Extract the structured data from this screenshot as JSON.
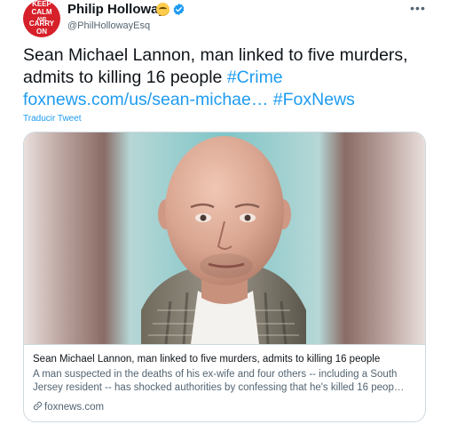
{
  "author": {
    "name": "Philip Holloway",
    "handle": "@PhilHollowayEsq",
    "avatar_text": [
      "KEEP",
      "CALM",
      "AND",
      "CARRY",
      "ON"
    ]
  },
  "tweet": {
    "text_line1": "Sean Michael Lannon, man linked to five murders,",
    "text_line2_plain": "admits to killing 16 people ",
    "hashtag_crime": "#Crime",
    "link_text": "foxnews.com/us/sean-michae…",
    "hashtag_foxnews": "#FoxNews",
    "translate_label": "Traducir Tweet"
  },
  "card": {
    "title": "Sean Michael Lannon, man linked to five murders, admits to killing 16 people",
    "description": "A man suspected in the deaths of his ex-wife and four others -- including a South Jersey resident -- has shocked authorities by confessing that he's killed 16 peop…",
    "domain": "foxnews.com"
  },
  "icons": {
    "more": "more-options-icon",
    "verified": "verified-badge-icon",
    "emoji": "sunglasses-emoji-icon",
    "link": "link-icon"
  },
  "colors": {
    "link": "#1d9bf0",
    "verified": "#1d9bf0",
    "secondary_text": "#536471",
    "border": "#cfd9de",
    "avatar_bg": "#d6202a"
  }
}
